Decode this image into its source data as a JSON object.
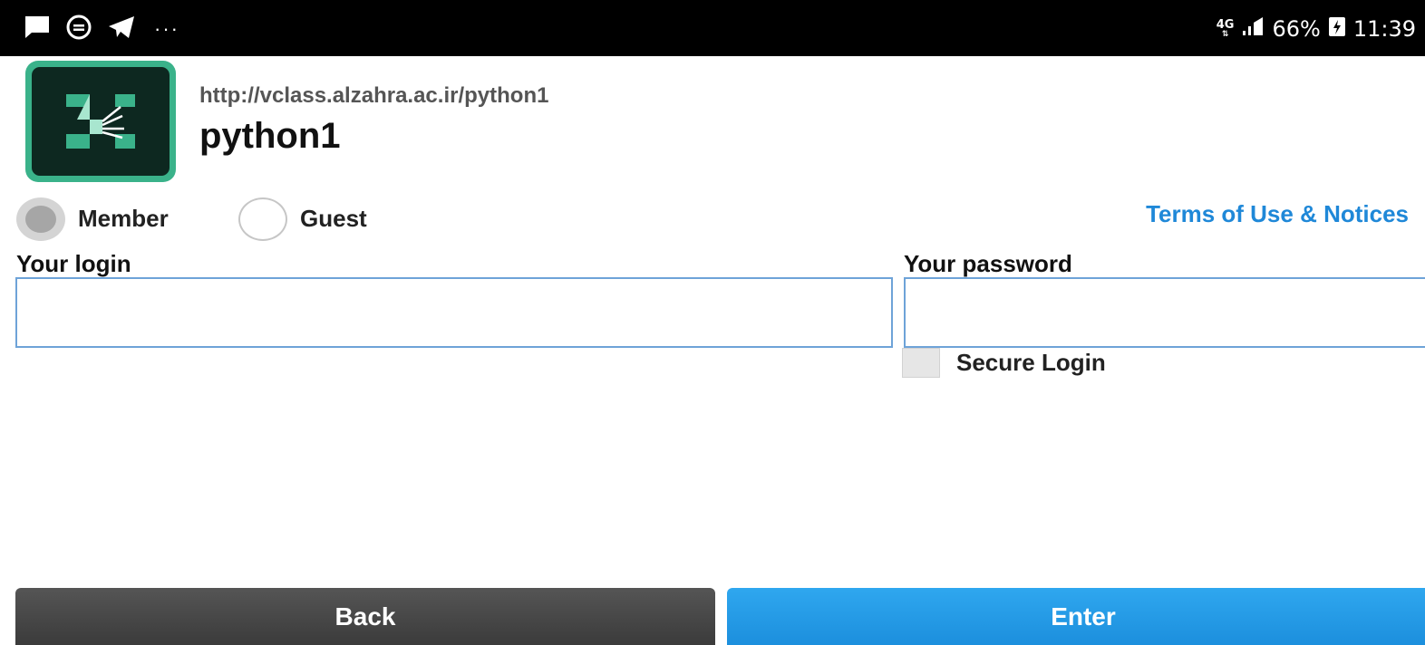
{
  "status_bar": {
    "network_type": "4G",
    "network_arrows": "⇅",
    "battery": "66%",
    "time": "11:39",
    "overflow": "···",
    "icons": [
      "message-icon",
      "sync-icon",
      "telegram-icon",
      "signal-icon",
      "battery-icon"
    ]
  },
  "app": {
    "room_url": "http://vclass.alzahra.ac.ir/python1",
    "room_name": "python1",
    "accent_color": "#3ab28a"
  },
  "login_type": {
    "options": [
      {
        "label": "Member",
        "selected": true
      },
      {
        "label": "Guest",
        "selected": false
      }
    ]
  },
  "terms_link": "Terms of Use & Notices",
  "form": {
    "login_label": "Your login",
    "login_value": "",
    "password_label": "Your password",
    "password_value": "",
    "secure_login_label": "Secure Login",
    "secure_login_checked": false
  },
  "buttons": {
    "back": "Back",
    "enter": "Enter"
  },
  "colors": {
    "link": "#1f88d8",
    "enter_button": "#1c8fdd",
    "back_button": "#444444",
    "input_border": "#6ea3d8"
  }
}
